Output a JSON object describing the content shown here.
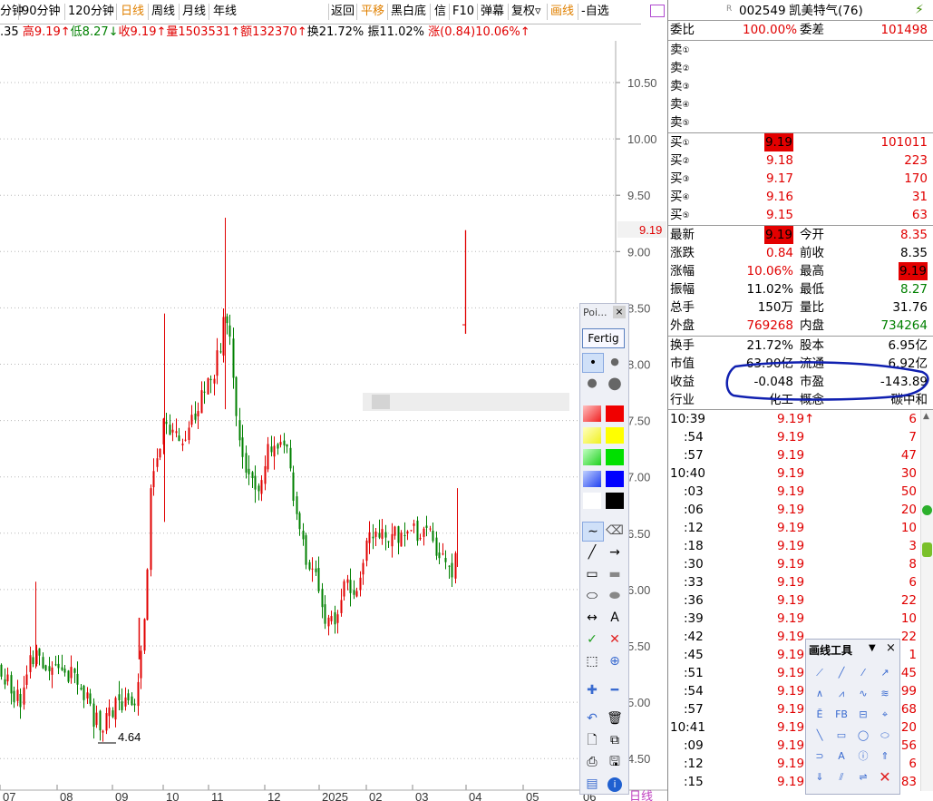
{
  "toolbar": {
    "items": [
      "分钟",
      "90分钟",
      "120分钟",
      "日线",
      "周线",
      "月线",
      "年线",
      "返回",
      "平移",
      "黑白底",
      "信",
      "F10",
      "弹幕",
      "复权▿",
      "画线",
      "-自选"
    ]
  },
  "info": {
    "prefix": ".35",
    "high": "高9.19↑",
    "low": "低8.27↓",
    "close": "收9.19↑",
    "volume": "量1503531↑",
    "amount": "额132370↑",
    "turnover": "换21.72%",
    "amplitude": "振11.02%",
    "change": "涨(0.84)10.06%↑"
  },
  "chart_data": {
    "type": "candlestick",
    "y_ticks": [
      "10.50",
      "10.00",
      "9.50",
      "9.00",
      "8.50",
      "8.00",
      "7.50",
      "7.00",
      "6.50",
      "6.00",
      "5.50",
      "5.00",
      "4.50"
    ],
    "x_ticks": [
      "07",
      "08",
      "09",
      "10",
      "11",
      "12",
      "2025",
      "02",
      "03",
      "04",
      "05",
      "06"
    ],
    "ylim": [
      4.35,
      10.95
    ],
    "last_price_label": "9.19",
    "low_annotation": "4.64",
    "period_label": "日线",
    "colors": {
      "up": "#e00000",
      "down": "#008000"
    }
  },
  "stock": {
    "code": "002549",
    "name": "凯美特气(76)",
    "flag": "R"
  },
  "order": {
    "ratio_label": "委比",
    "ratio_value": "100.00%",
    "diff_label": "委差",
    "diff_value": "101498"
  },
  "asks": [
    {
      "label": "卖",
      "n": "①"
    },
    {
      "label": "卖",
      "n": "②"
    },
    {
      "label": "卖",
      "n": "③"
    },
    {
      "label": "卖",
      "n": "④"
    },
    {
      "label": "卖",
      "n": "⑤"
    }
  ],
  "bids": [
    {
      "label": "买",
      "n": "①",
      "price": "9.19",
      "vol": "101011"
    },
    {
      "label": "买",
      "n": "②",
      "price": "9.18",
      "vol": "223"
    },
    {
      "label": "买",
      "n": "③",
      "price": "9.17",
      "vol": "170"
    },
    {
      "label": "买",
      "n": "④",
      "price": "9.16",
      "vol": "31"
    },
    {
      "label": "买",
      "n": "⑤",
      "price": "9.15",
      "vol": "63"
    }
  ],
  "stats": [
    {
      "l1": "最新",
      "v1": "9.19",
      "l2": "今开",
      "v2": "8.35"
    },
    {
      "l1": "涨跌",
      "v1": "0.84",
      "l2": "前收",
      "v2": "8.35"
    },
    {
      "l1": "涨幅",
      "v1": "10.06%",
      "l2": "最高",
      "v2": "9.19"
    },
    {
      "l1": "振幅",
      "v1": "11.02%",
      "l2": "最低",
      "v2": "8.27"
    },
    {
      "l1": "总手",
      "v1": "150万",
      "l2": "量比",
      "v2": "31.76"
    },
    {
      "l1": "外盘",
      "v1": "769268",
      "l2": "内盘",
      "v2": "734264"
    }
  ],
  "fund": [
    {
      "l1": "换手",
      "v1": "21.72%",
      "l2": "股本",
      "v2": "6.95亿"
    },
    {
      "l1": "市值",
      "v1": "63.90亿",
      "l2": "流通",
      "v2": "6.92亿"
    },
    {
      "l1": "收益",
      "v1": "-0.048",
      "l2": "市盈",
      "v2": "-143.89"
    },
    {
      "l1": "行业",
      "v1": "化工",
      "l2": "概念",
      "v2": "碳中和"
    }
  ],
  "ticks": [
    {
      "t": "10:39",
      "p": "9.19↑",
      "v": "6"
    },
    {
      "t": ":54",
      "p": "9.19",
      "v": "7"
    },
    {
      "t": ":57",
      "p": "9.19",
      "v": "47"
    },
    {
      "t": "10:40",
      "p": "9.19",
      "v": "30"
    },
    {
      "t": ":03",
      "p": "9.19",
      "v": "50"
    },
    {
      "t": ":06",
      "p": "9.19",
      "v": "20"
    },
    {
      "t": ":12",
      "p": "9.19",
      "v": "10"
    },
    {
      "t": ":18",
      "p": "9.19",
      "v": "3"
    },
    {
      "t": ":30",
      "p": "9.19",
      "v": "8"
    },
    {
      "t": ":33",
      "p": "9.19",
      "v": "6"
    },
    {
      "t": ":36",
      "p": "9.19",
      "v": "22"
    },
    {
      "t": ":39",
      "p": "9.19",
      "v": "10"
    },
    {
      "t": ":42",
      "p": "9.19",
      "v": "22"
    },
    {
      "t": ":45",
      "p": "9.19",
      "v": "1"
    },
    {
      "t": ":51",
      "p": "9.19",
      "v": "45"
    },
    {
      "t": ":54",
      "p": "9.19",
      "v": "99"
    },
    {
      "t": ":57",
      "p": "9.19",
      "v": "68"
    },
    {
      "t": "10:41",
      "p": "9.19",
      "v": "20"
    },
    {
      "t": ":09",
      "p": "9.19",
      "v": "56"
    },
    {
      "t": ":12",
      "p": "9.19",
      "v": "6"
    },
    {
      "t": ":15",
      "p": "9.19",
      "v": "83"
    }
  ],
  "poi_panel": {
    "title": "Poi...",
    "close": "×",
    "done_button": "Fertig",
    "text_tool": "A"
  },
  "draw_panel": {
    "title": "画线工具",
    "dropdown": "▼",
    "close": "×"
  }
}
